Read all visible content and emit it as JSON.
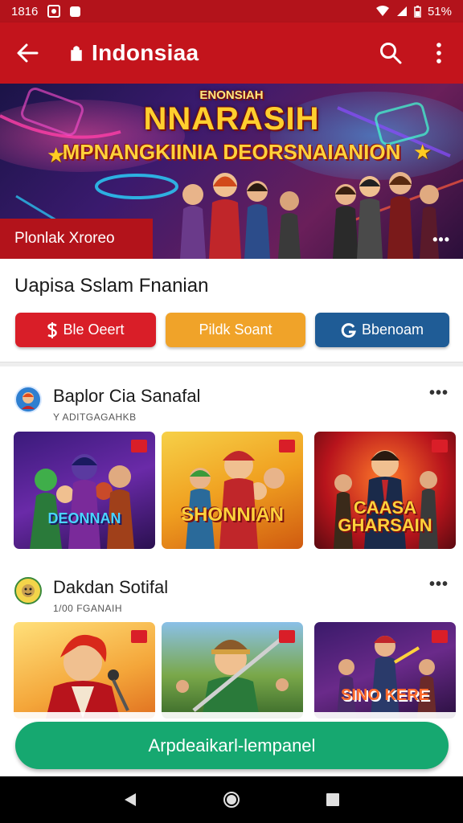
{
  "status_bar": {
    "time": "1816",
    "battery": "51%"
  },
  "app_bar": {
    "title": "Indonsiaa"
  },
  "banner": {
    "kicker": "ENONSIAH",
    "title": "NNARASIH",
    "subtitle": "MPNANGKIINIA DEORSNAIANION",
    "badge": "Plonlak Xroreo",
    "more": "•••"
  },
  "section": {
    "title": "Uapisa Sslam Fnanian",
    "buttons": [
      {
        "label": "Ble Oeert",
        "icon": "dollar-icon",
        "color": "#d91e28"
      },
      {
        "label": "Pildk Soant",
        "icon": "",
        "color": "#f0a329"
      },
      {
        "label": "Bbenoam",
        "icon": "g-icon",
        "color": "#1f5c96"
      }
    ]
  },
  "rows": [
    {
      "name": "Baplor Cia Sanafal",
      "meta": "Y ADITGAGAHKB",
      "more": "•••",
      "tiles": [
        {
          "label": "DEONNAN"
        },
        {
          "label": "SHONNIAN"
        },
        {
          "label": "CAASA GHARSAIN"
        }
      ]
    },
    {
      "name": "Dakdan Sotifal",
      "meta": "1/00 FGANAIH",
      "more": "•••",
      "tiles": [
        {
          "label": ""
        },
        {
          "label": ""
        },
        {
          "label": "SINO KERE"
        }
      ]
    }
  ],
  "cta": {
    "label": "Arpdeaikarl-lempanel"
  }
}
